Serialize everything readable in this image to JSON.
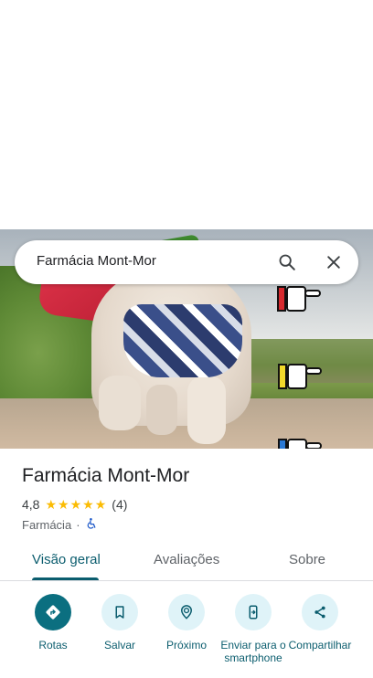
{
  "search": {
    "query": "Farmácia Mont-Mor"
  },
  "place": {
    "name": "Farmácia Mont-Mor",
    "rating": "4,8",
    "review_count": "(4)",
    "stars": 5,
    "category": "Farmácia",
    "separator": "·"
  },
  "tabs": [
    {
      "label": "Visão geral",
      "active": true
    },
    {
      "label": "Avaliações",
      "active": false
    },
    {
      "label": "Sobre",
      "active": false
    }
  ],
  "actions": [
    {
      "label": "Rotas",
      "icon": "directions-icon",
      "primary": true
    },
    {
      "label": "Salvar",
      "icon": "bookmark-icon",
      "primary": false
    },
    {
      "label": "Próximo",
      "icon": "nearby-icon",
      "primary": false
    },
    {
      "label": "Enviar para o smartphone",
      "icon": "send-to-phone-icon",
      "primary": false
    },
    {
      "label": "Compartilhar",
      "icon": "share-icon",
      "primary": false
    }
  ],
  "colors": {
    "accent": "#0b5d6e",
    "accent_fill": "#0b6f80",
    "chip_bg": "#dff3f8",
    "star": "#fbbc04"
  }
}
